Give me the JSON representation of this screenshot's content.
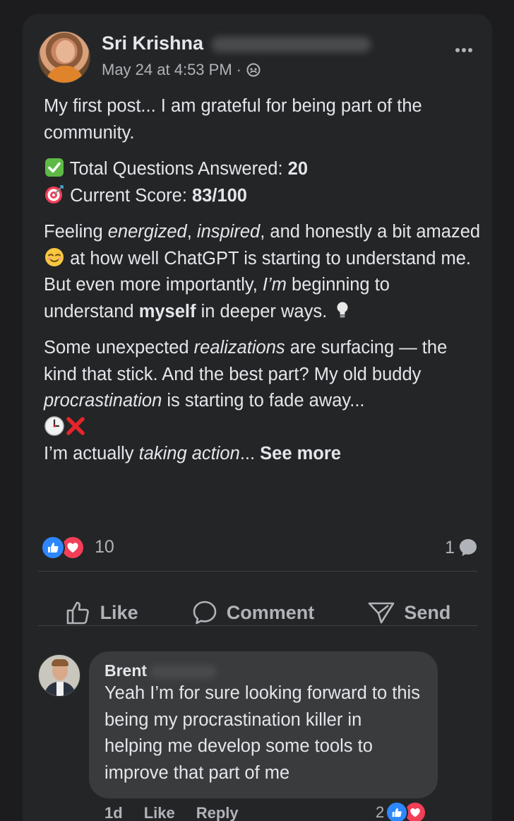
{
  "post": {
    "author_name": "Sri Krishna",
    "timestamp": "May 24 at 4:53 PM",
    "meta_separator": "·",
    "intro": "My first post... I am grateful for being part of the community.",
    "stats": [
      {
        "icon": "check-mark-icon",
        "label": "Total Questions Answered: ",
        "value": "20"
      },
      {
        "icon": "target-icon",
        "label": "Current Score: ",
        "value": "83/100"
      }
    ],
    "p3": {
      "a": "Feeling ",
      "b": "energized",
      "c": ", ",
      "d": "inspired",
      "e": ", and honestly a bit amazed ",
      "f": " at how well ChatGPT is starting to understand me. But even more importantly, ",
      "g": "I’m",
      "h": " beginning to understand ",
      "i": "myself",
      "j": " in deeper ways. "
    },
    "p4": {
      "a": "Some unexpected ",
      "b": "realizations",
      "c": " are surfacing — the kind that stick. And the best part? My old buddy ",
      "d": "procrastination",
      "e": " is starting to fade away...",
      "f": "I’m actually ",
      "g": "taking action",
      "h": "... ",
      "see_more": "See more"
    },
    "reaction_count": "10",
    "comment_count": "1"
  },
  "actions": {
    "like": "Like",
    "comment": "Comment",
    "send": "Send"
  },
  "comment": {
    "author_name": "Brent",
    "text": "Yeah I’m for sure looking forward to this being my procrastination killer in helping me develop some tools to improve that part of me",
    "age": "1d",
    "like": "Like",
    "reply": "Reply",
    "reaction_count": "2"
  },
  "colors": {
    "background": "#1c1c1e",
    "card": "#242526",
    "bubble": "#3a3b3c",
    "like_blue": "#2d88ff",
    "love_red": "#f33e58"
  }
}
